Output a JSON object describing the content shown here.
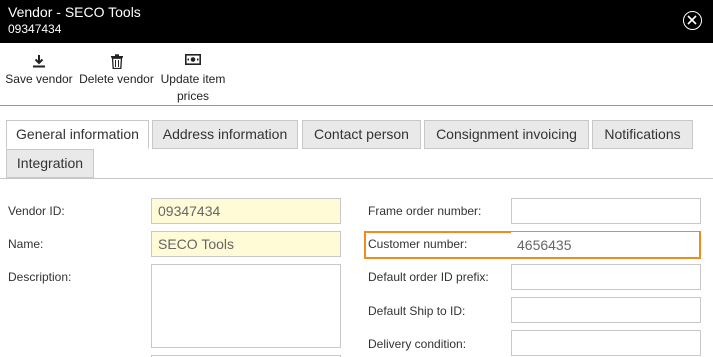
{
  "window": {
    "title": "Vendor - SECO Tools",
    "subtitle": "09347434"
  },
  "toolbar": {
    "save_label": "Save vendor",
    "delete_label": "Delete vendor",
    "update_label_line1": "Update item",
    "update_label_line2": "prices"
  },
  "tabs": [
    {
      "label": "General information",
      "active": true
    },
    {
      "label": "Address information"
    },
    {
      "label": "Contact person"
    },
    {
      "label": "Consignment invoicing"
    },
    {
      "label": "Notifications"
    },
    {
      "label": "Integration"
    }
  ],
  "form": {
    "vendor_id_label": "Vendor ID:",
    "vendor_id_value": "09347434",
    "name_label": "Name:",
    "name_value": "SECO Tools",
    "description_label": "Description:",
    "description_value": "",
    "frame_order_label": "Frame order number:",
    "frame_order_value": "",
    "customer_number_label": "Customer number:",
    "customer_number_value": "4656435",
    "order_prefix_label": "Default order ID prefix:",
    "order_prefix_value": "",
    "ship_to_label": "Default Ship to ID:",
    "ship_to_value": "",
    "delivery_condition_label": "Delivery condition:",
    "delivery_condition_value": ""
  },
  "colors": {
    "titlebar": "#000000",
    "highlight_field": "#fffbd6",
    "focus_ring": "#f08c1e",
    "toolbar_divider": "#5fa8c8"
  },
  "icons": [
    "close-icon",
    "download-icon",
    "trash-icon",
    "money-icon"
  ]
}
